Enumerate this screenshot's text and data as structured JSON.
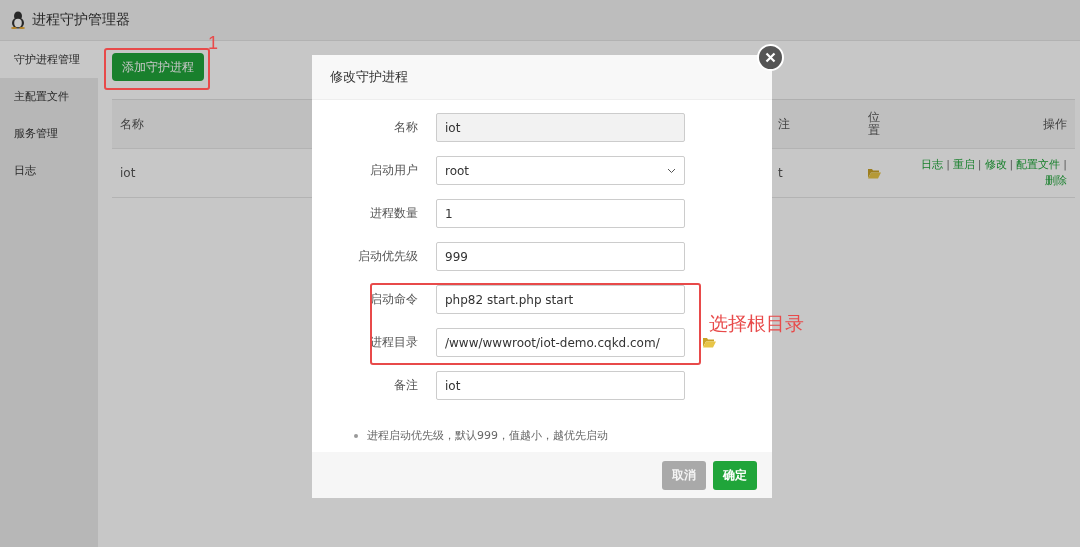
{
  "app": {
    "title": "进程守护管理器"
  },
  "sidebar": {
    "items": [
      {
        "label": "守护进程管理",
        "selected": true
      },
      {
        "label": "主配置文件",
        "selected": false
      },
      {
        "label": "服务管理",
        "selected": false
      },
      {
        "label": "日志",
        "selected": false
      }
    ]
  },
  "toolbar": {
    "add_button": "添加守护进程"
  },
  "table": {
    "columns": [
      "名称",
      "注",
      "位置",
      "操作"
    ],
    "rows": [
      {
        "name": "iot",
        "column_2": "t",
        "actions": [
          "日志",
          "重启",
          "修改",
          "配置文件",
          "删除"
        ]
      }
    ],
    "separator": "|"
  },
  "dialog": {
    "title": "修改守护进程",
    "fields": [
      {
        "label": "名称",
        "kind": "readonly",
        "value": "iot"
      },
      {
        "label": "启动用户",
        "kind": "select",
        "value": "root"
      },
      {
        "label": "进程数量",
        "kind": "text",
        "value": "1"
      },
      {
        "label": "启动优先级",
        "kind": "text",
        "value": "999"
      },
      {
        "label": "启动命令",
        "kind": "text",
        "value": "php82 start.php start"
      },
      {
        "label": "进程目录",
        "kind": "path",
        "value": "/www/wwwroot/iot-demo.cqkd.com/"
      },
      {
        "label": "备注",
        "kind": "text",
        "value": "iot"
      }
    ],
    "note": "进程启动优先级，默认999，值越小，越优先启动",
    "buttons": [
      {
        "label": "取消",
        "kind": "secondary"
      },
      {
        "label": "确定",
        "kind": "primary"
      }
    ]
  },
  "annotations": [
    {
      "kind": "numbered",
      "text": "1"
    },
    {
      "kind": "captioned",
      "text": "选择根目录"
    }
  ]
}
